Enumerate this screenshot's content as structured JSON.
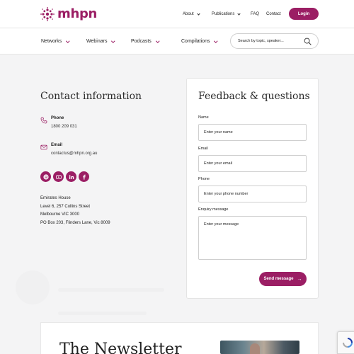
{
  "brand": {
    "name": "mhpn",
    "color": "#9b1e64"
  },
  "topnav": {
    "about": "About",
    "publications": "Publications",
    "faq": "FAQ",
    "contact": "Contact",
    "login": "Login"
  },
  "subnav": {
    "items": [
      {
        "label": "Networks"
      },
      {
        "label": "Webinars"
      },
      {
        "label": "Podcasts"
      },
      {
        "label": "Compilations"
      }
    ],
    "search": {
      "placeholder": "Search by topic, speaker..."
    }
  },
  "contact": {
    "title": "Contact information",
    "phone": {
      "label": "Phone",
      "value": "1800 209 031"
    },
    "email": {
      "label": "Email",
      "value": "contactus@mhpn.org.au"
    },
    "socials": [
      "spotify-icon",
      "youtube-icon",
      "linkedin-icon",
      "facebook-icon"
    ],
    "address": [
      "Emirates House",
      "Level 6, 257 Collins Street",
      "Melbourne VIC 3000",
      "PO Box 203, Flinders Lane, Vic 8009"
    ]
  },
  "feedback": {
    "title": "Feedback & questions",
    "name_label": "Name",
    "name_placeholder": "Enter your name",
    "email_label": "Email",
    "email_placeholder": "Enter your email",
    "phone_label": "Phone",
    "phone_placeholder": "Enter your phone number",
    "message_label": "Enquiry message",
    "message_placeholder": "Enter your message",
    "send_label": "Send message"
  },
  "newsletter": {
    "title": "The Newsletter"
  }
}
